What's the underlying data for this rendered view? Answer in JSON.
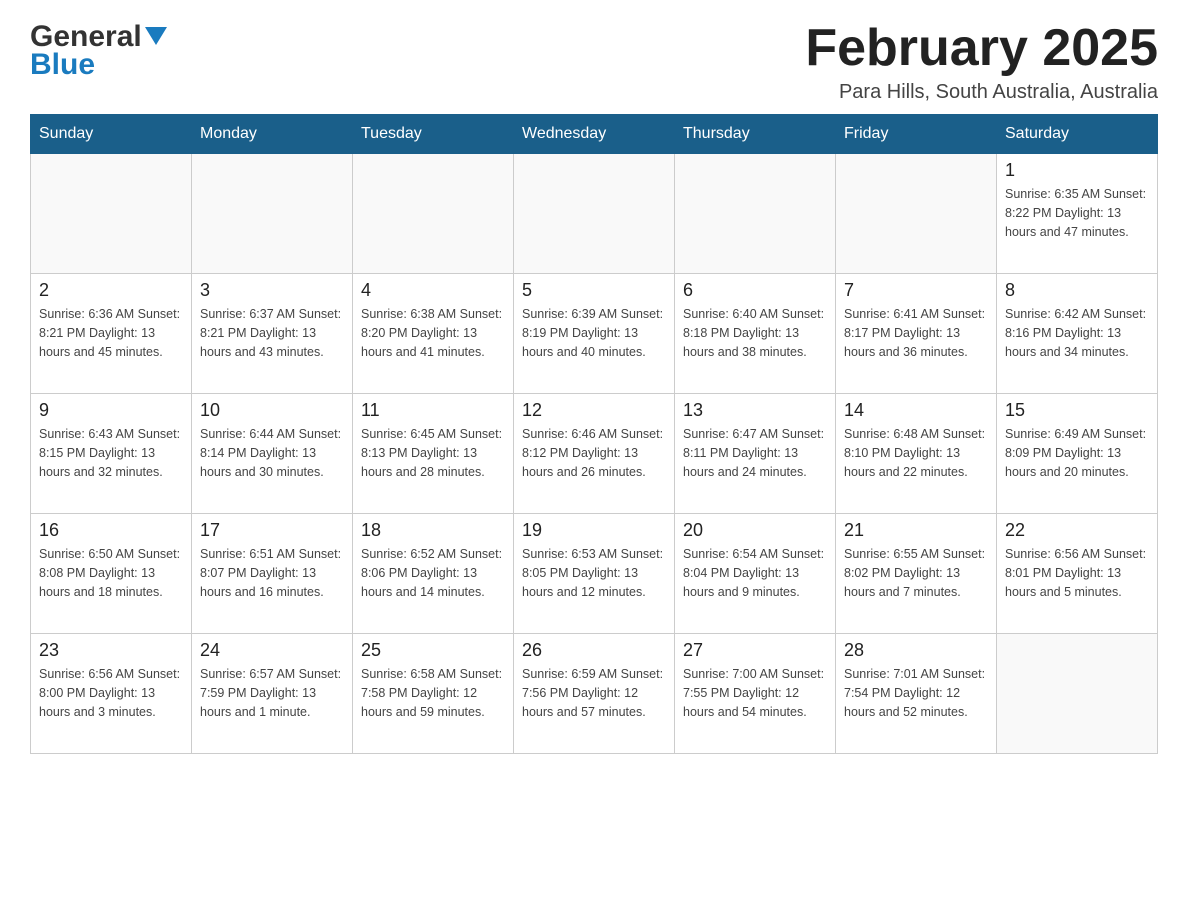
{
  "header": {
    "logo_general": "General",
    "logo_blue": "Blue",
    "title": "February 2025",
    "subtitle": "Para Hills, South Australia, Australia"
  },
  "weekdays": [
    "Sunday",
    "Monday",
    "Tuesday",
    "Wednesday",
    "Thursday",
    "Friday",
    "Saturday"
  ],
  "weeks": [
    [
      {
        "day": "",
        "info": ""
      },
      {
        "day": "",
        "info": ""
      },
      {
        "day": "",
        "info": ""
      },
      {
        "day": "",
        "info": ""
      },
      {
        "day": "",
        "info": ""
      },
      {
        "day": "",
        "info": ""
      },
      {
        "day": "1",
        "info": "Sunrise: 6:35 AM\nSunset: 8:22 PM\nDaylight: 13 hours and 47 minutes."
      }
    ],
    [
      {
        "day": "2",
        "info": "Sunrise: 6:36 AM\nSunset: 8:21 PM\nDaylight: 13 hours and 45 minutes."
      },
      {
        "day": "3",
        "info": "Sunrise: 6:37 AM\nSunset: 8:21 PM\nDaylight: 13 hours and 43 minutes."
      },
      {
        "day": "4",
        "info": "Sunrise: 6:38 AM\nSunset: 8:20 PM\nDaylight: 13 hours and 41 minutes."
      },
      {
        "day": "5",
        "info": "Sunrise: 6:39 AM\nSunset: 8:19 PM\nDaylight: 13 hours and 40 minutes."
      },
      {
        "day": "6",
        "info": "Sunrise: 6:40 AM\nSunset: 8:18 PM\nDaylight: 13 hours and 38 minutes."
      },
      {
        "day": "7",
        "info": "Sunrise: 6:41 AM\nSunset: 8:17 PM\nDaylight: 13 hours and 36 minutes."
      },
      {
        "day": "8",
        "info": "Sunrise: 6:42 AM\nSunset: 8:16 PM\nDaylight: 13 hours and 34 minutes."
      }
    ],
    [
      {
        "day": "9",
        "info": "Sunrise: 6:43 AM\nSunset: 8:15 PM\nDaylight: 13 hours and 32 minutes."
      },
      {
        "day": "10",
        "info": "Sunrise: 6:44 AM\nSunset: 8:14 PM\nDaylight: 13 hours and 30 minutes."
      },
      {
        "day": "11",
        "info": "Sunrise: 6:45 AM\nSunset: 8:13 PM\nDaylight: 13 hours and 28 minutes."
      },
      {
        "day": "12",
        "info": "Sunrise: 6:46 AM\nSunset: 8:12 PM\nDaylight: 13 hours and 26 minutes."
      },
      {
        "day": "13",
        "info": "Sunrise: 6:47 AM\nSunset: 8:11 PM\nDaylight: 13 hours and 24 minutes."
      },
      {
        "day": "14",
        "info": "Sunrise: 6:48 AM\nSunset: 8:10 PM\nDaylight: 13 hours and 22 minutes."
      },
      {
        "day": "15",
        "info": "Sunrise: 6:49 AM\nSunset: 8:09 PM\nDaylight: 13 hours and 20 minutes."
      }
    ],
    [
      {
        "day": "16",
        "info": "Sunrise: 6:50 AM\nSunset: 8:08 PM\nDaylight: 13 hours and 18 minutes."
      },
      {
        "day": "17",
        "info": "Sunrise: 6:51 AM\nSunset: 8:07 PM\nDaylight: 13 hours and 16 minutes."
      },
      {
        "day": "18",
        "info": "Sunrise: 6:52 AM\nSunset: 8:06 PM\nDaylight: 13 hours and 14 minutes."
      },
      {
        "day": "19",
        "info": "Sunrise: 6:53 AM\nSunset: 8:05 PM\nDaylight: 13 hours and 12 minutes."
      },
      {
        "day": "20",
        "info": "Sunrise: 6:54 AM\nSunset: 8:04 PM\nDaylight: 13 hours and 9 minutes."
      },
      {
        "day": "21",
        "info": "Sunrise: 6:55 AM\nSunset: 8:02 PM\nDaylight: 13 hours and 7 minutes."
      },
      {
        "day": "22",
        "info": "Sunrise: 6:56 AM\nSunset: 8:01 PM\nDaylight: 13 hours and 5 minutes."
      }
    ],
    [
      {
        "day": "23",
        "info": "Sunrise: 6:56 AM\nSunset: 8:00 PM\nDaylight: 13 hours and 3 minutes."
      },
      {
        "day": "24",
        "info": "Sunrise: 6:57 AM\nSunset: 7:59 PM\nDaylight: 13 hours and 1 minute."
      },
      {
        "day": "25",
        "info": "Sunrise: 6:58 AM\nSunset: 7:58 PM\nDaylight: 12 hours and 59 minutes."
      },
      {
        "day": "26",
        "info": "Sunrise: 6:59 AM\nSunset: 7:56 PM\nDaylight: 12 hours and 57 minutes."
      },
      {
        "day": "27",
        "info": "Sunrise: 7:00 AM\nSunset: 7:55 PM\nDaylight: 12 hours and 54 minutes."
      },
      {
        "day": "28",
        "info": "Sunrise: 7:01 AM\nSunset: 7:54 PM\nDaylight: 12 hours and 52 minutes."
      },
      {
        "day": "",
        "info": ""
      }
    ]
  ]
}
